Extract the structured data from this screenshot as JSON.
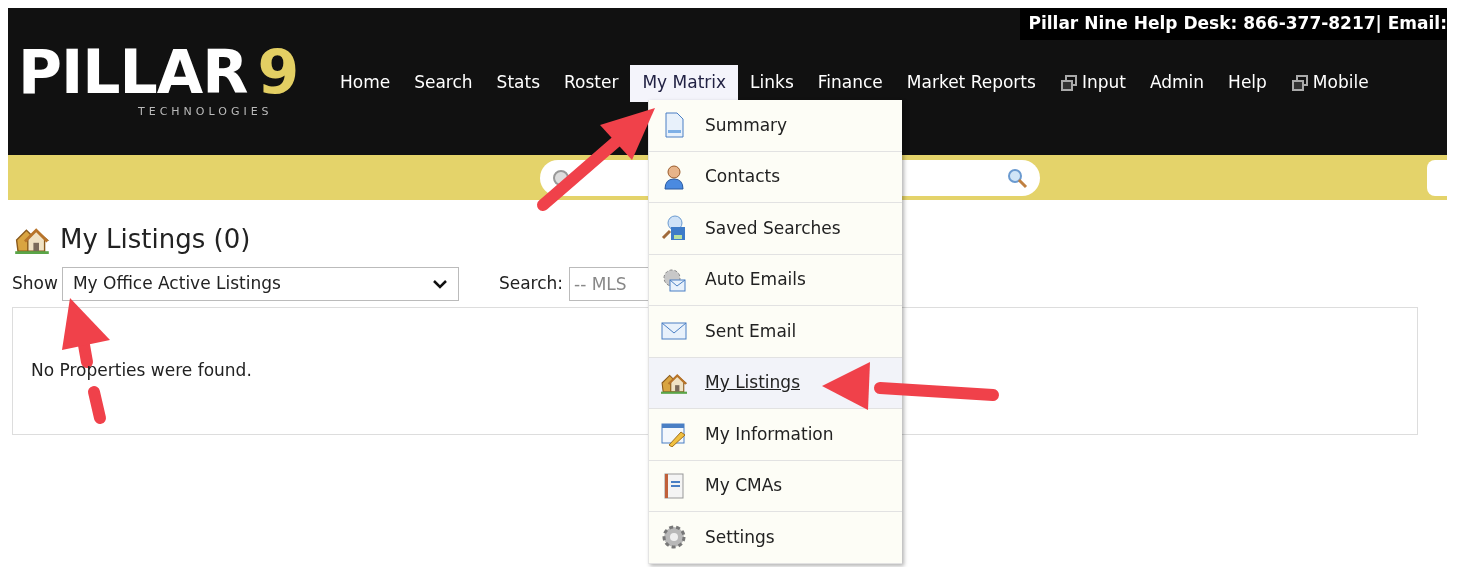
{
  "help_desk": "Pillar Nine Help Desk: 866-377-8217| Email:",
  "logo": {
    "name": "PILLAR",
    "number": "9",
    "tagline": "TECHNOLOGIES"
  },
  "nav": [
    {
      "label": "Home",
      "selected": false,
      "kind": "link"
    },
    {
      "label": "Search",
      "selected": false,
      "kind": "link"
    },
    {
      "label": "Stats",
      "selected": false,
      "kind": "link"
    },
    {
      "label": "Roster",
      "selected": false,
      "kind": "link"
    },
    {
      "label": "My Matrix",
      "selected": true,
      "kind": "link"
    },
    {
      "label": "Links",
      "selected": false,
      "kind": "link"
    },
    {
      "label": "Finance",
      "selected": false,
      "kind": "link"
    },
    {
      "label": "Market Reports",
      "selected": false,
      "kind": "link"
    },
    {
      "label": "Input",
      "selected": false,
      "kind": "popup"
    },
    {
      "label": "Admin",
      "selected": false,
      "kind": "link"
    },
    {
      "label": "Help",
      "selected": false,
      "kind": "link"
    },
    {
      "label": "Mobile",
      "selected": false,
      "kind": "popup"
    }
  ],
  "menu": [
    {
      "label": "Summary",
      "selected": false
    },
    {
      "label": "Contacts",
      "selected": false
    },
    {
      "label": "Saved Searches",
      "selected": false
    },
    {
      "label": "Auto Emails",
      "selected": false
    },
    {
      "label": "Sent Email",
      "selected": false
    },
    {
      "label": "My Listings",
      "selected": true
    },
    {
      "label": "My Information",
      "selected": false
    },
    {
      "label": "My CMAs",
      "selected": false
    },
    {
      "label": "Settings",
      "selected": false
    }
  ],
  "page_title": "My Listings (0)",
  "show": {
    "label": "Show",
    "value": "My Office Active Listings"
  },
  "search": {
    "label": "Search:",
    "placeholder": "-- MLS"
  },
  "empty_message": "No Properties were found."
}
